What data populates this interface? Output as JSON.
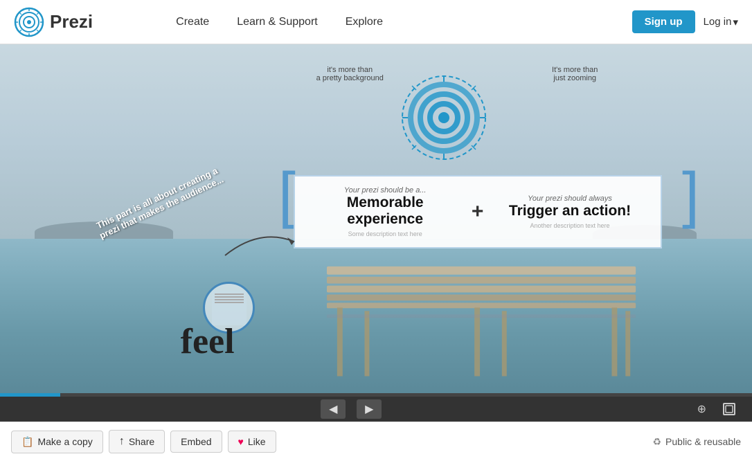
{
  "header": {
    "logo_text": "Prezi",
    "nav": {
      "create": "Create",
      "learn_support": "Learn & Support",
      "explore": "Explore"
    },
    "signup_label": "Sign up",
    "login_label": "Log in",
    "login_arrow": "▾"
  },
  "presentation": {
    "top_label_left_line1": "it's more than",
    "top_label_left_line2": "a pretty background",
    "top_label_right_line1": "It's more than",
    "top_label_right_line2": "just zooming",
    "memorable_subtitle": "Your prezi should be a...",
    "memorable_title": "Memorable experience",
    "plus": "+",
    "trigger_subtitle": "Your prezi should always",
    "trigger_title": "Trigger an action!",
    "feel_text": "feel",
    "diagonal_text_line1": "This part is all about creating a",
    "diagonal_text_line2": "prezi that makes the audience..."
  },
  "controls": {
    "prev_arrow": "◀",
    "next_arrow": "▶",
    "zoom_icon": "⊕",
    "fullscreen_icon": "⛶"
  },
  "action_bar": {
    "make_copy_icon": "📋",
    "make_copy_label": "Make a copy",
    "share_icon": "↑",
    "share_label": "Share",
    "embed_label": "Embed",
    "like_icon": "♥",
    "like_label": "Like",
    "public_icon": "♻",
    "public_label": "Public & reusable"
  }
}
